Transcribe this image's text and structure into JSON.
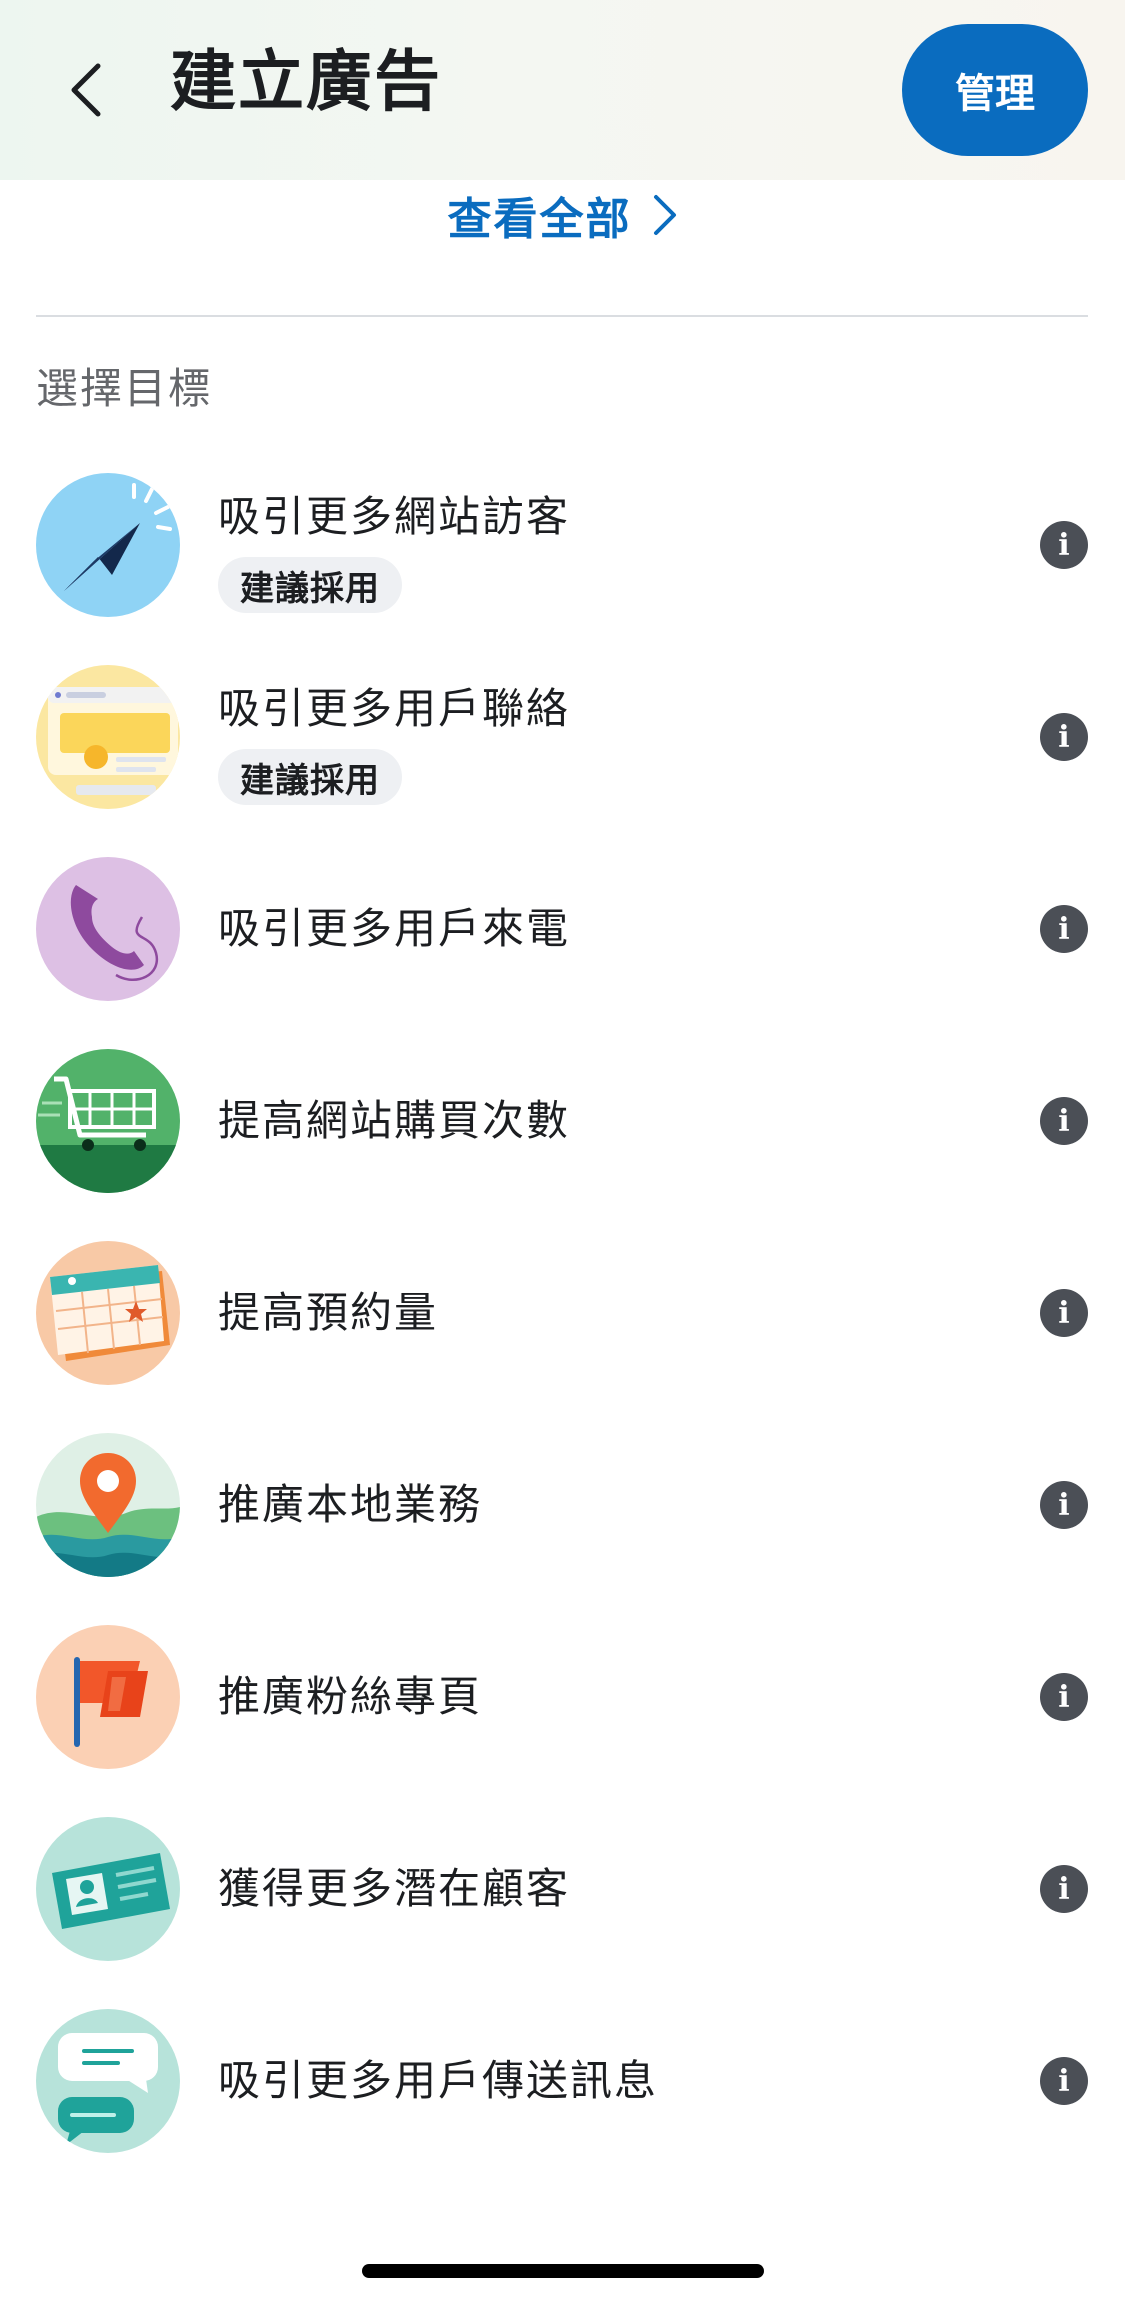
{
  "header": {
    "title": "建立廣告",
    "manage_label": "管理"
  },
  "see_all": {
    "label": "查看全部"
  },
  "section_title": "選擇目標",
  "objectives": [
    {
      "label": "吸引更多網站訪客",
      "badge": "建議採用",
      "icon": "cursor-click-icon"
    },
    {
      "label": "吸引更多用戶聯絡",
      "badge": "建議採用",
      "icon": "contact-form-icon"
    },
    {
      "label": "吸引更多用戶來電",
      "badge": "",
      "icon": "phone-icon"
    },
    {
      "label": "提高網站購買次數",
      "badge": "",
      "icon": "shopping-cart-icon"
    },
    {
      "label": "提高預約量",
      "badge": "",
      "icon": "calendar-icon"
    },
    {
      "label": "推廣本地業務",
      "badge": "",
      "icon": "map-pin-icon"
    },
    {
      "label": "推廣粉絲專頁",
      "badge": "",
      "icon": "flag-icon"
    },
    {
      "label": "獲得更多潛在顧客",
      "badge": "",
      "icon": "id-card-icon"
    },
    {
      "label": "吸引更多用戶傳送訊息",
      "badge": "",
      "icon": "chat-bubbles-icon"
    }
  ],
  "info_glyph": "i",
  "colors": {
    "accent": "#0a6cbf",
    "info_icon": "#4b4f56",
    "badge_bg": "#eef0f3"
  }
}
